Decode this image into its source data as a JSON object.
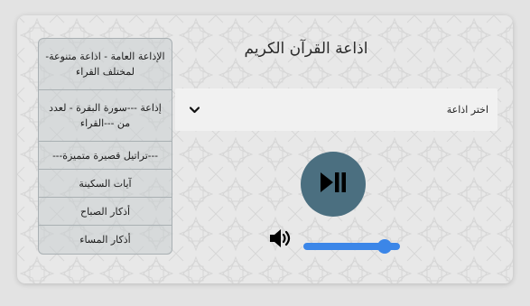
{
  "title": "اذاعة القرآن الكريم",
  "station_select": {
    "value": "اختر اذاعة"
  },
  "player": {
    "play_button_icon": "play-pause-icon",
    "volume_icon": "speaker-icon",
    "volume_level": 0.9
  },
  "menu": {
    "items": [
      {
        "label": "الإذاعة العامة - اذاعة متنوعة- لمختلف القراء"
      },
      {
        "label": "إذاعة ---سورة البقرة - لعدد من ---القراء"
      },
      {
        "label": "---تراتيل قصيرة متميزة---"
      },
      {
        "label": "آيات السكينة"
      },
      {
        "label": "أذكار الصباح"
      },
      {
        "label": "أذكار المساء"
      }
    ]
  },
  "colors": {
    "play_button": "#4b6f80",
    "slider": "#3b86e8",
    "card_background": "#e8e8e8"
  }
}
